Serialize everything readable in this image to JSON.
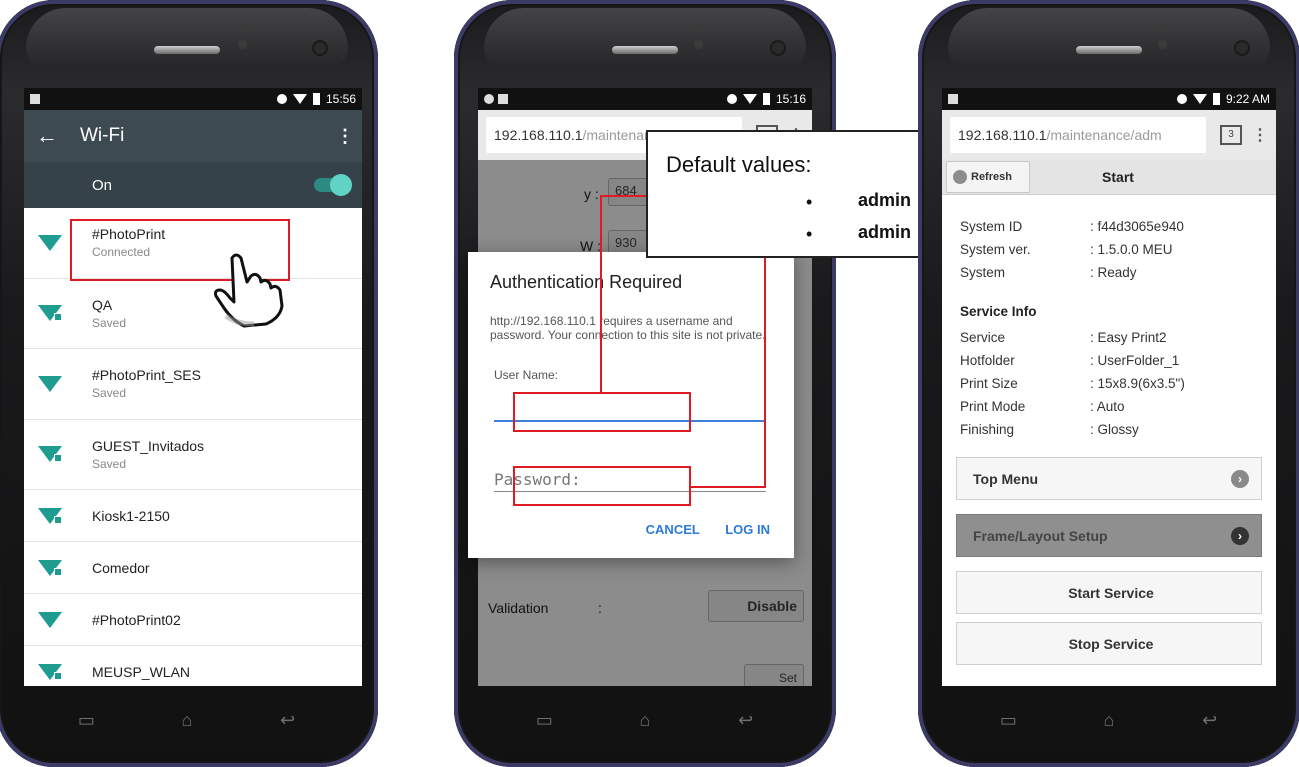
{
  "phone1": {
    "status_time": "15:56",
    "header_title": "Wi-Fi",
    "toggle_label": "On",
    "networks": [
      {
        "name": "#PhotoPrint",
        "status": "Connected"
      },
      {
        "name": "QA",
        "status": "Saved"
      },
      {
        "name": "#PhotoPrint_SES",
        "status": "Saved"
      },
      {
        "name": "GUEST_Invitados",
        "status": "Saved"
      },
      {
        "name": "Kiosk1-2150",
        "status": ""
      },
      {
        "name": "Comedor",
        "status": ""
      },
      {
        "name": "#PhotoPrint02",
        "status": ""
      },
      {
        "name": "MEUSP_WLAN",
        "status": ""
      }
    ]
  },
  "phone2": {
    "status_time": "15:16",
    "url_host": "192.168.110.1",
    "url_path": "/maintenance/adm",
    "tab_count": "3",
    "bg_y_label": "y :",
    "bg_y_value": "684",
    "bg_w_label": "W :",
    "bg_w_value": "930",
    "validation_label": "Validation",
    "validation_colon": ":",
    "validation_value": "Disable",
    "set_label": "Set",
    "dialog": {
      "title": "Authentication Required",
      "message": "http://192.168.110.1 requires a username and password. Your connection to this site is not private.",
      "username_label": "User Name:",
      "password_placeholder": "Password:",
      "cancel_label": "CANCEL",
      "login_label": "LOG IN"
    },
    "callout": {
      "heading": "Default values:",
      "values": [
        "admin",
        "admin"
      ]
    }
  },
  "phone3": {
    "status_time": "9:22 AM",
    "url_host": "192.168.110.1",
    "url_path": "/maintenance/adm",
    "tab_count": "3",
    "refresh_label": "Refresh",
    "page_title": "Start",
    "system_rows": [
      {
        "key": "System ID",
        "value": ": f44d3065e940"
      },
      {
        "key": "System ver.",
        "value": ": 1.5.0.0 MEU"
      },
      {
        "key": "System",
        "value": ": Ready"
      }
    ],
    "service_heading": "Service Info",
    "service_rows": [
      {
        "key": "Service",
        "value": ": Easy Print2"
      },
      {
        "key": "Hotfolder",
        "value": ": UserFolder_1"
      },
      {
        "key": "Print Size",
        "value": ": 15x8.9(6x3.5\")"
      },
      {
        "key": "Print Mode",
        "value": ": Auto"
      },
      {
        "key": "Finishing",
        "value": ": Glossy"
      }
    ],
    "buttons": {
      "top_menu": "Top Menu",
      "frame_layout": "Frame/Layout Setup",
      "start_service": "Start Service",
      "stop_service": "Stop Service"
    }
  },
  "colors": {
    "wifi_header": "#3e4a51",
    "wifi_teal": "#1d9c8f",
    "highlight_red": "#e01a22",
    "dialog_blue": "#2b7bd6"
  }
}
